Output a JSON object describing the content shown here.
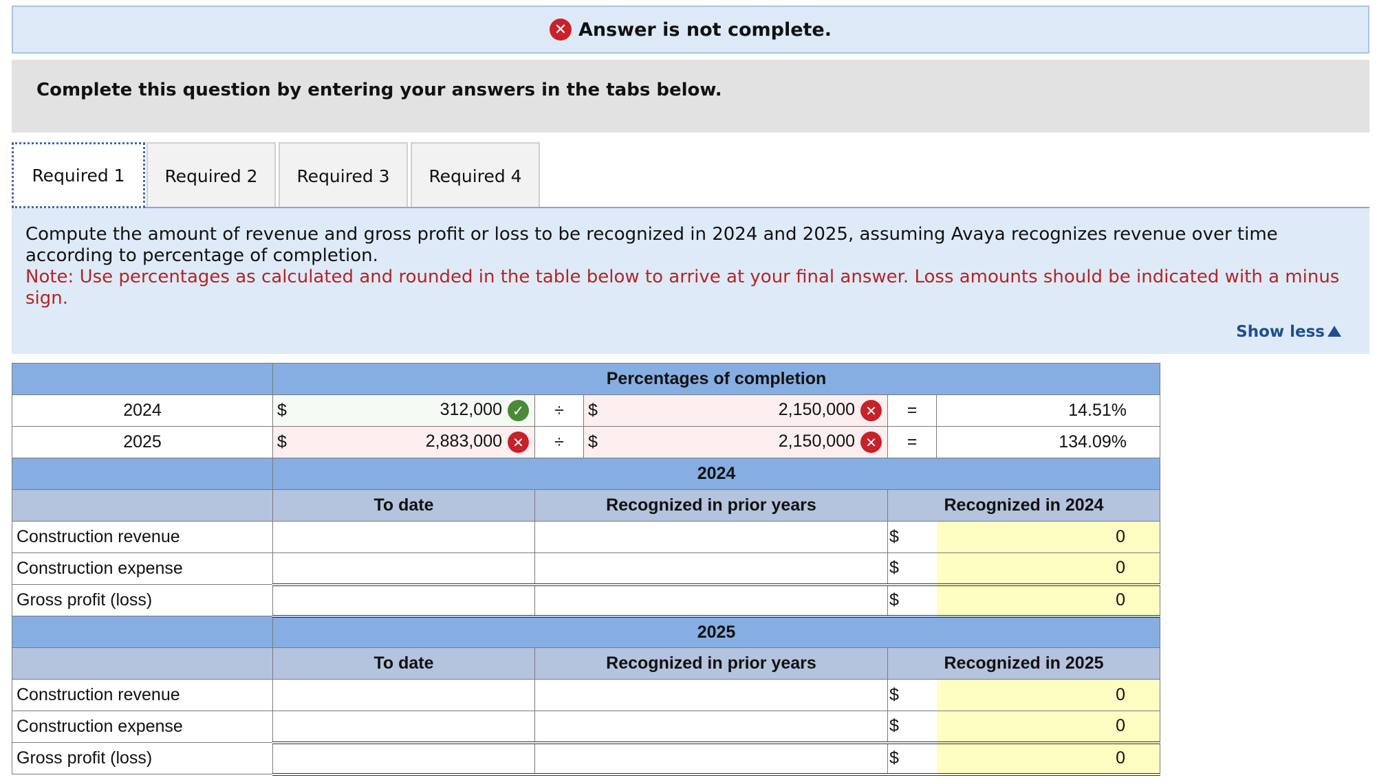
{
  "banner": {
    "status_text": "Answer is not complete.",
    "icon": "x-circle-icon"
  },
  "instructions": "Complete this question by entering your answers in the tabs below.",
  "tabs": [
    {
      "label": "Required 1",
      "active": true
    },
    {
      "label": "Required 2",
      "active": false
    },
    {
      "label": "Required 3",
      "active": false
    },
    {
      "label": "Required 4",
      "active": false
    }
  ],
  "prompt": {
    "text": "Compute the amount of revenue and gross profit or loss to be recognized in 2024 and 2025, assuming Avaya recognizes revenue over time according to percentage of completion.",
    "note": "Note: Use percentages as calculated and rounded in the table below to arrive at your final answer. Loss amounts should be indicated with a minus sign."
  },
  "show_less": "Show less",
  "pct_table": {
    "header": "Percentages of completion",
    "rows": [
      {
        "year": "2024",
        "dollar": "$",
        "numerator": "312,000",
        "numerator_status": "correct",
        "divide": "÷",
        "denominator": "2,150,000",
        "denominator_status": "incorrect",
        "equals": "=",
        "result": "14.51%"
      },
      {
        "year": "2025",
        "dollar": "$",
        "numerator": "2,883,000",
        "numerator_status": "incorrect",
        "divide": "÷",
        "denominator": "2,150,000",
        "denominator_status": "incorrect",
        "equals": "=",
        "result": "134.09%"
      }
    ]
  },
  "sections": [
    {
      "year": "2024",
      "col_to_date": "To date",
      "col_prior": "Recognized in prior years",
      "col_current": "Recognized in 2024",
      "rows": [
        {
          "label": "Construction revenue",
          "dollar": "$",
          "value": "0"
        },
        {
          "label": "Construction expense",
          "dollar": "$",
          "value": "0"
        },
        {
          "label": "Gross profit (loss)",
          "dollar": "$",
          "value": "0"
        }
      ]
    },
    {
      "year": "2025",
      "col_to_date": "To date",
      "col_prior": "Recognized in prior years",
      "col_current": "Recognized in 2025",
      "rows": [
        {
          "label": "Construction revenue",
          "dollar": "$",
          "value": "0"
        },
        {
          "label": "Construction expense",
          "dollar": "$",
          "value": "0"
        },
        {
          "label": "Gross profit (loss)",
          "dollar": "$",
          "value": "0"
        }
      ]
    }
  ],
  "colors": {
    "banner_bg": "#dde9f7",
    "header_blue": "#86aee2",
    "subheader": "#b4c3de",
    "highlight_yellow": "#fefec2",
    "error_red": "#c8212a",
    "check_green": "#4a8a3a",
    "note_red": "#b32525"
  }
}
